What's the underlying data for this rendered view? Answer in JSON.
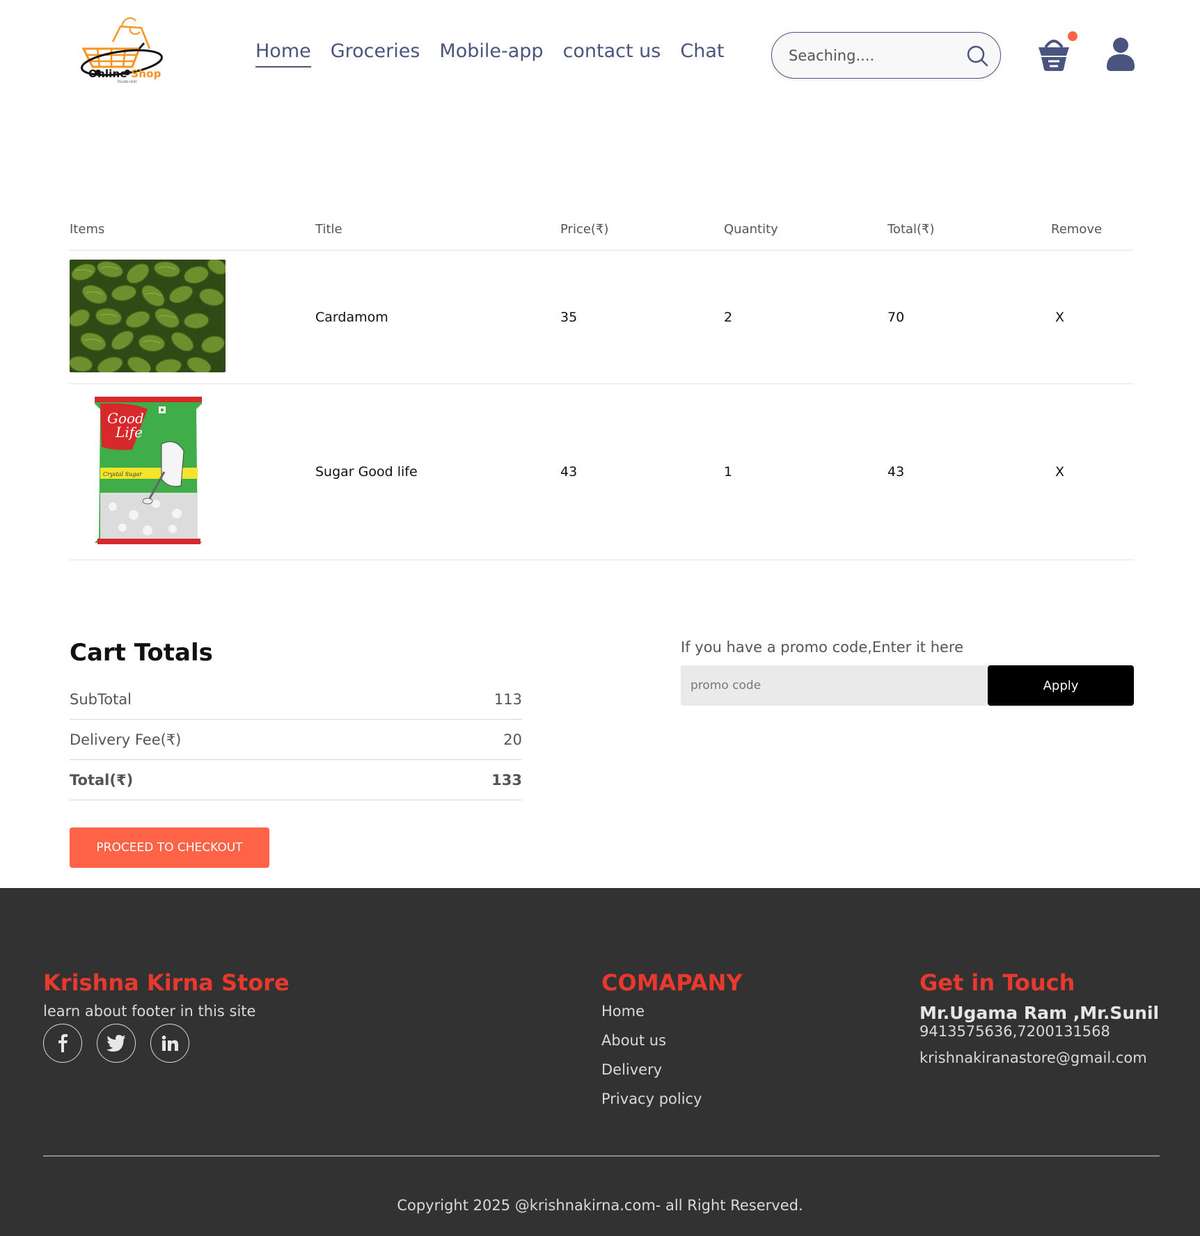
{
  "header": {
    "logo": {
      "word1": "Online",
      "word2": "Shop",
      "tagline": "TAGLINE HERE"
    },
    "nav": [
      {
        "label": "Home",
        "active": true
      },
      {
        "label": "Groceries"
      },
      {
        "label": "Mobile-app"
      },
      {
        "label": "contact us"
      },
      {
        "label": "Chat"
      }
    ],
    "search": {
      "placeholder": "Seaching....",
      "icon": "search-icon"
    },
    "cart": {
      "icon": "basket-icon",
      "has_notification": true,
      "notification_color": "#ff6347"
    },
    "profile": {
      "icon": "profile-icon"
    }
  },
  "cart_table": {
    "headers": [
      "Items",
      "Title",
      "Price(₹)",
      "Quantity",
      "Total(₹)",
      "Remove"
    ],
    "items": [
      {
        "image": "cardamom-image",
        "title": "Cardamom",
        "price": "35",
        "quantity": "2",
        "total": "70",
        "remove": "X"
      },
      {
        "image": "sugar-good-life-image",
        "title": "Sugar Good life",
        "price": "43",
        "quantity": "1",
        "total": "43",
        "remove": "X"
      }
    ]
  },
  "cart_totals": {
    "heading": "Cart Totals",
    "subtotal_label": "SubTotal",
    "subtotal_value": "113",
    "delivery_label": "Delivery Fee(₹)",
    "delivery_value": "20",
    "total_label": "Total(₹)",
    "total_value": "133",
    "checkout_label": "PROCEED TO CHECKOUT"
  },
  "promo": {
    "label": "If you have a promo code,Enter it here",
    "placeholder": "promo code",
    "apply_label": "Apply"
  },
  "footer": {
    "store_name": "Krishna Kirna Store",
    "store_tagline": "learn about footer in this site",
    "socials": [
      "facebook-icon",
      "twitter-icon",
      "linkedin-icon"
    ],
    "company_heading": "COMAPANY",
    "company_links": [
      "Home",
      "About us",
      "Delivery",
      "Privacy policy"
    ],
    "contact_heading": "Get in Touch",
    "contact_names": "Mr.Ugama Ram ,Mr.Sunil",
    "contact_phone": "9413575636,7200131568",
    "contact_email": "krishnakiranastore@gmail.com",
    "copyright": "Copyright 2025 @krishnakirna.com- all Right Reserved."
  },
  "colors": {
    "nav": "#49557e",
    "accent": "#ff6347",
    "footer_bg": "#323232",
    "footer_heading": "#e8392e"
  }
}
